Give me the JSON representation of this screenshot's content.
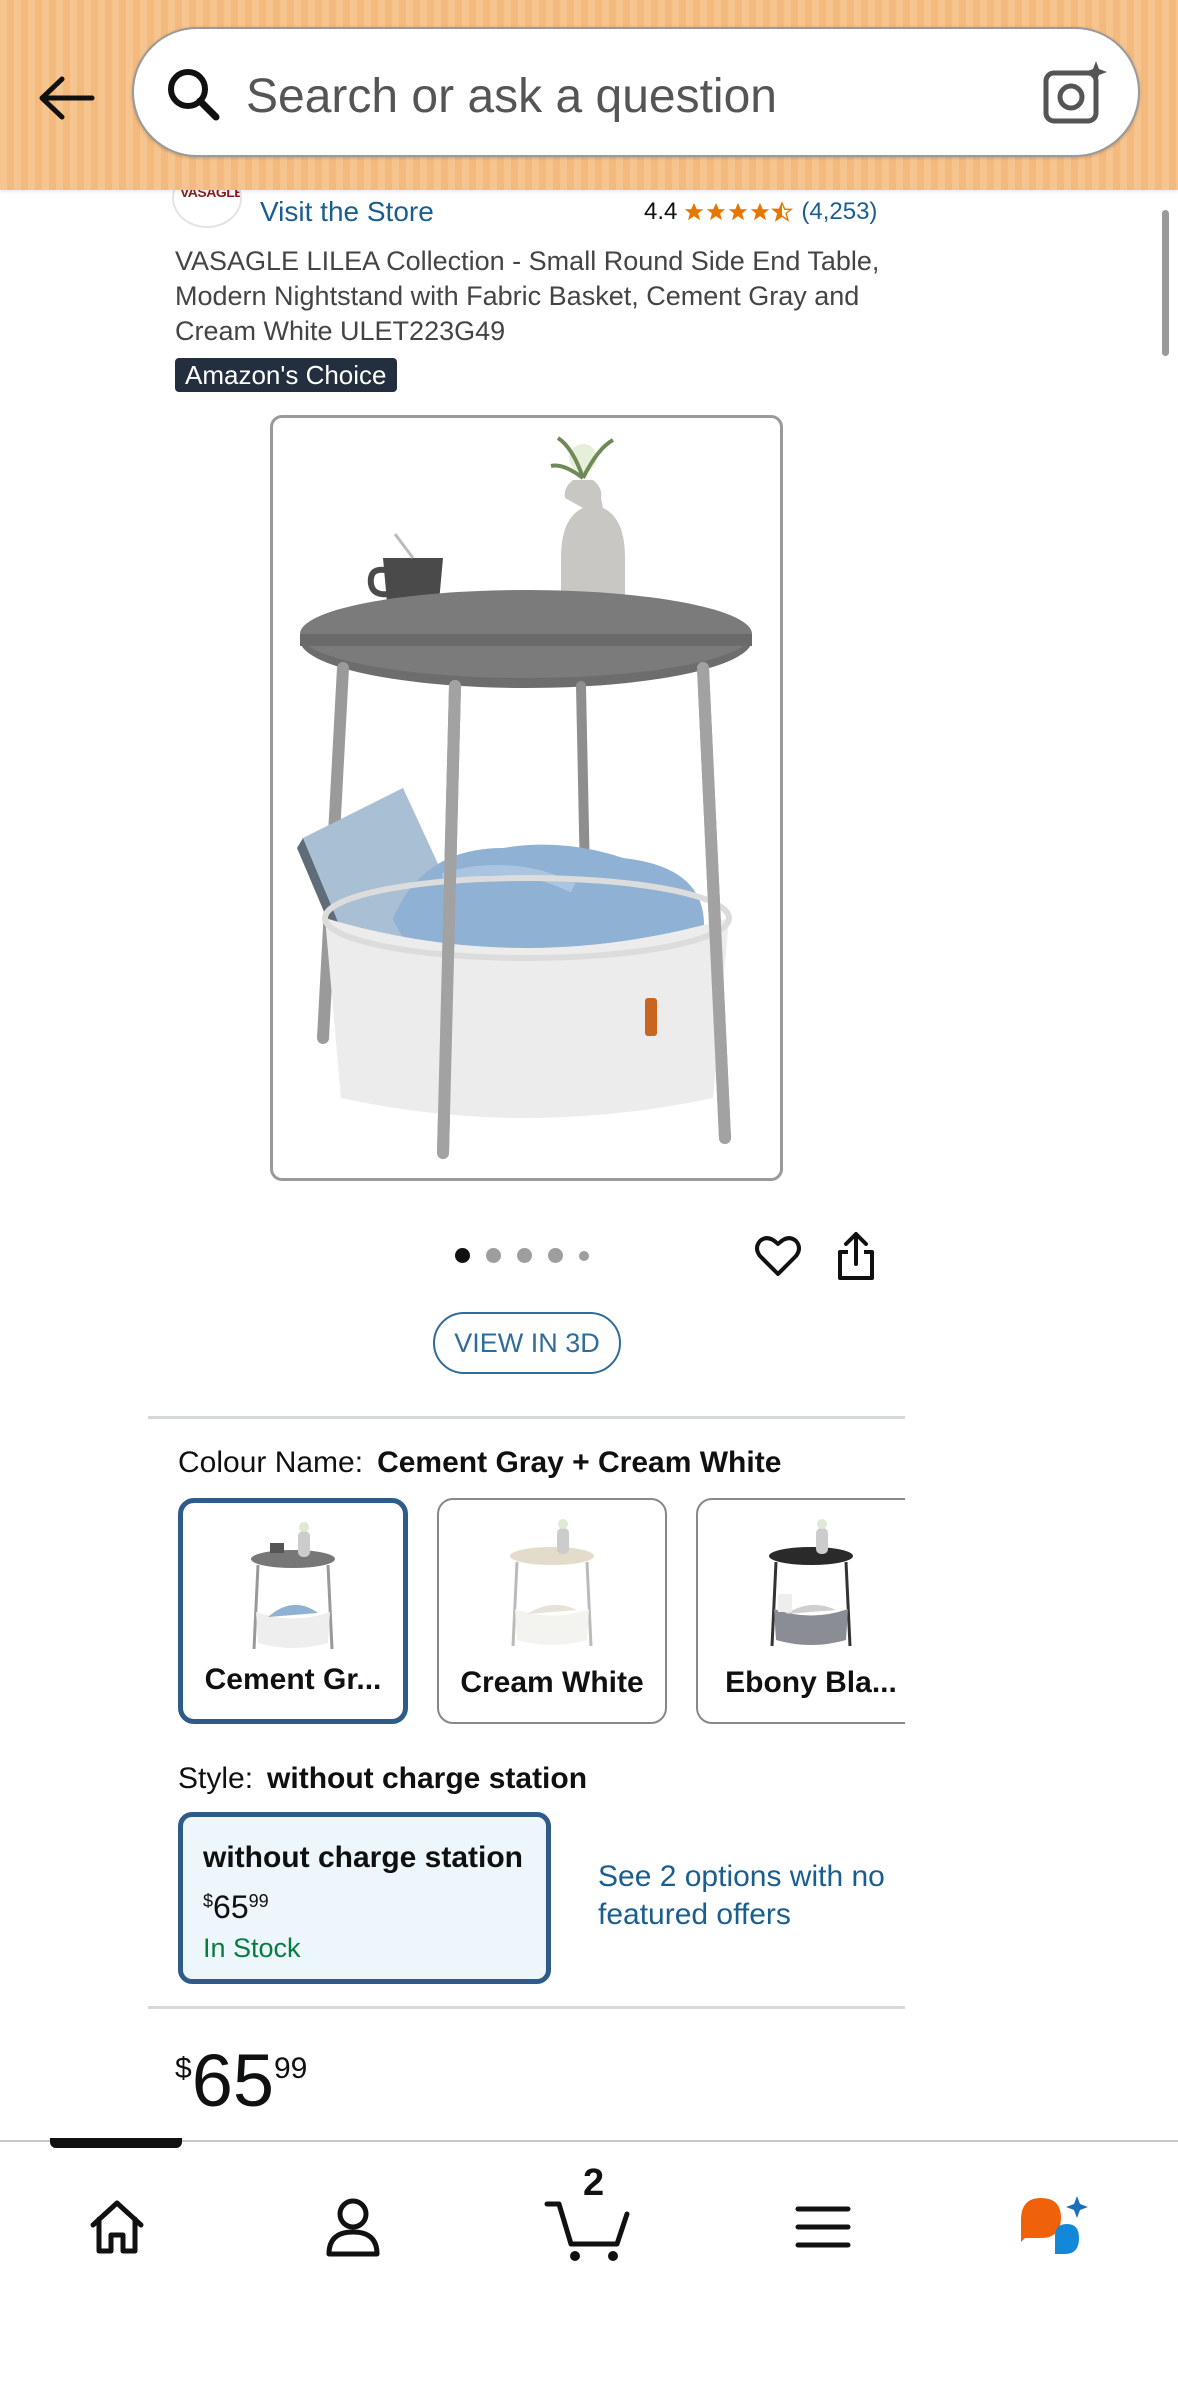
{
  "header": {
    "search_placeholder": "Search or ask a question"
  },
  "store": {
    "logo_text": "VASAGLE",
    "visit_label": "Visit the Store",
    "rating_value": "4.4",
    "rating_count": "(4,253)",
    "stars": 4.4
  },
  "product": {
    "title": "VASAGLE LILEA Collection - Small Round Side End Table, Modern Nightstand with Fabric Basket, Cement Gray and Cream White ULET223G49",
    "badge": "Amazon's Choice",
    "image_count": 5,
    "active_image": 1,
    "view_3d_label": "VIEW IN 3D"
  },
  "colour": {
    "label": "Colour Name:",
    "selected": "Cement Gray + Cream White",
    "options": [
      {
        "label": "Cement Gr..."
      },
      {
        "label": "Cream White"
      },
      {
        "label": "Ebony Bla..."
      }
    ]
  },
  "style": {
    "label": "Style:",
    "selected": "without charge station",
    "option": {
      "name": "without charge station",
      "price_symbol": "$",
      "price_whole": "65",
      "price_cents": "99",
      "stock": "In Stock"
    },
    "see_options": "See 2 options with no featured offers"
  },
  "price": {
    "symbol": "$",
    "whole": "65",
    "cents": "99"
  },
  "bottom_nav": {
    "cart_count": "2"
  },
  "colors": {
    "header_bg": "#f6c48e",
    "link": "#1a5e8f",
    "selected_border": "#2f5b8a",
    "in_stock": "#067d3e",
    "star": "#e77600"
  }
}
